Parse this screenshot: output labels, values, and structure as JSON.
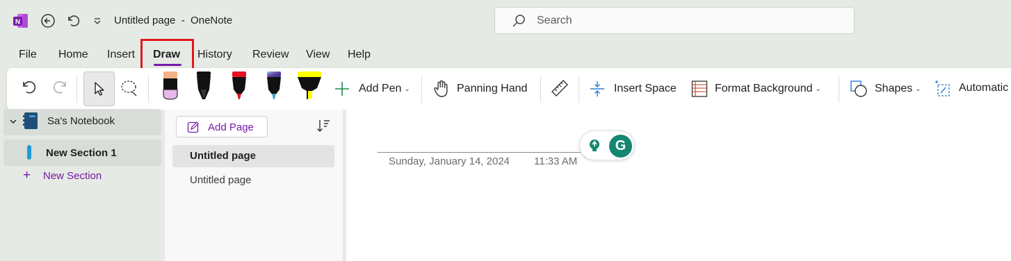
{
  "window": {
    "title": "Untitled page  -  OneNote",
    "logo": "onenote-logo-icon"
  },
  "search": {
    "placeholder": "Search"
  },
  "menu": {
    "tabs": [
      "File",
      "Home",
      "Insert",
      "Draw",
      "History",
      "Review",
      "View",
      "Help"
    ],
    "active": "Draw"
  },
  "ribbon": {
    "add_pen": "Add Pen",
    "panning_hand": "Panning Hand",
    "insert_space": "Insert Space",
    "format_background": "Format Background",
    "shapes": "Shapes",
    "automation": "Automatic",
    "pens": [
      {
        "name": "pencil",
        "color": "#e7b7e8"
      },
      {
        "name": "pen-black",
        "color": "#000000"
      },
      {
        "name": "pen-red",
        "color": "#e81123"
      },
      {
        "name": "pen-galaxy",
        "color": "#3a86c8"
      },
      {
        "name": "highlighter-yellow",
        "color": "#ffff00"
      }
    ]
  },
  "notebook": {
    "name": "Sa's Notebook",
    "section": "New Section 1",
    "new_section": "New Section"
  },
  "pages": {
    "add_page": "Add Page",
    "items": [
      "Untitled page",
      "Untitled page"
    ]
  },
  "canvas": {
    "date": "Sunday, January 14, 2024",
    "time": "11:33 AM"
  },
  "colors": {
    "accent": "#7719aa",
    "highlight_box": "#e0191f",
    "grammarly": "#15866f"
  }
}
